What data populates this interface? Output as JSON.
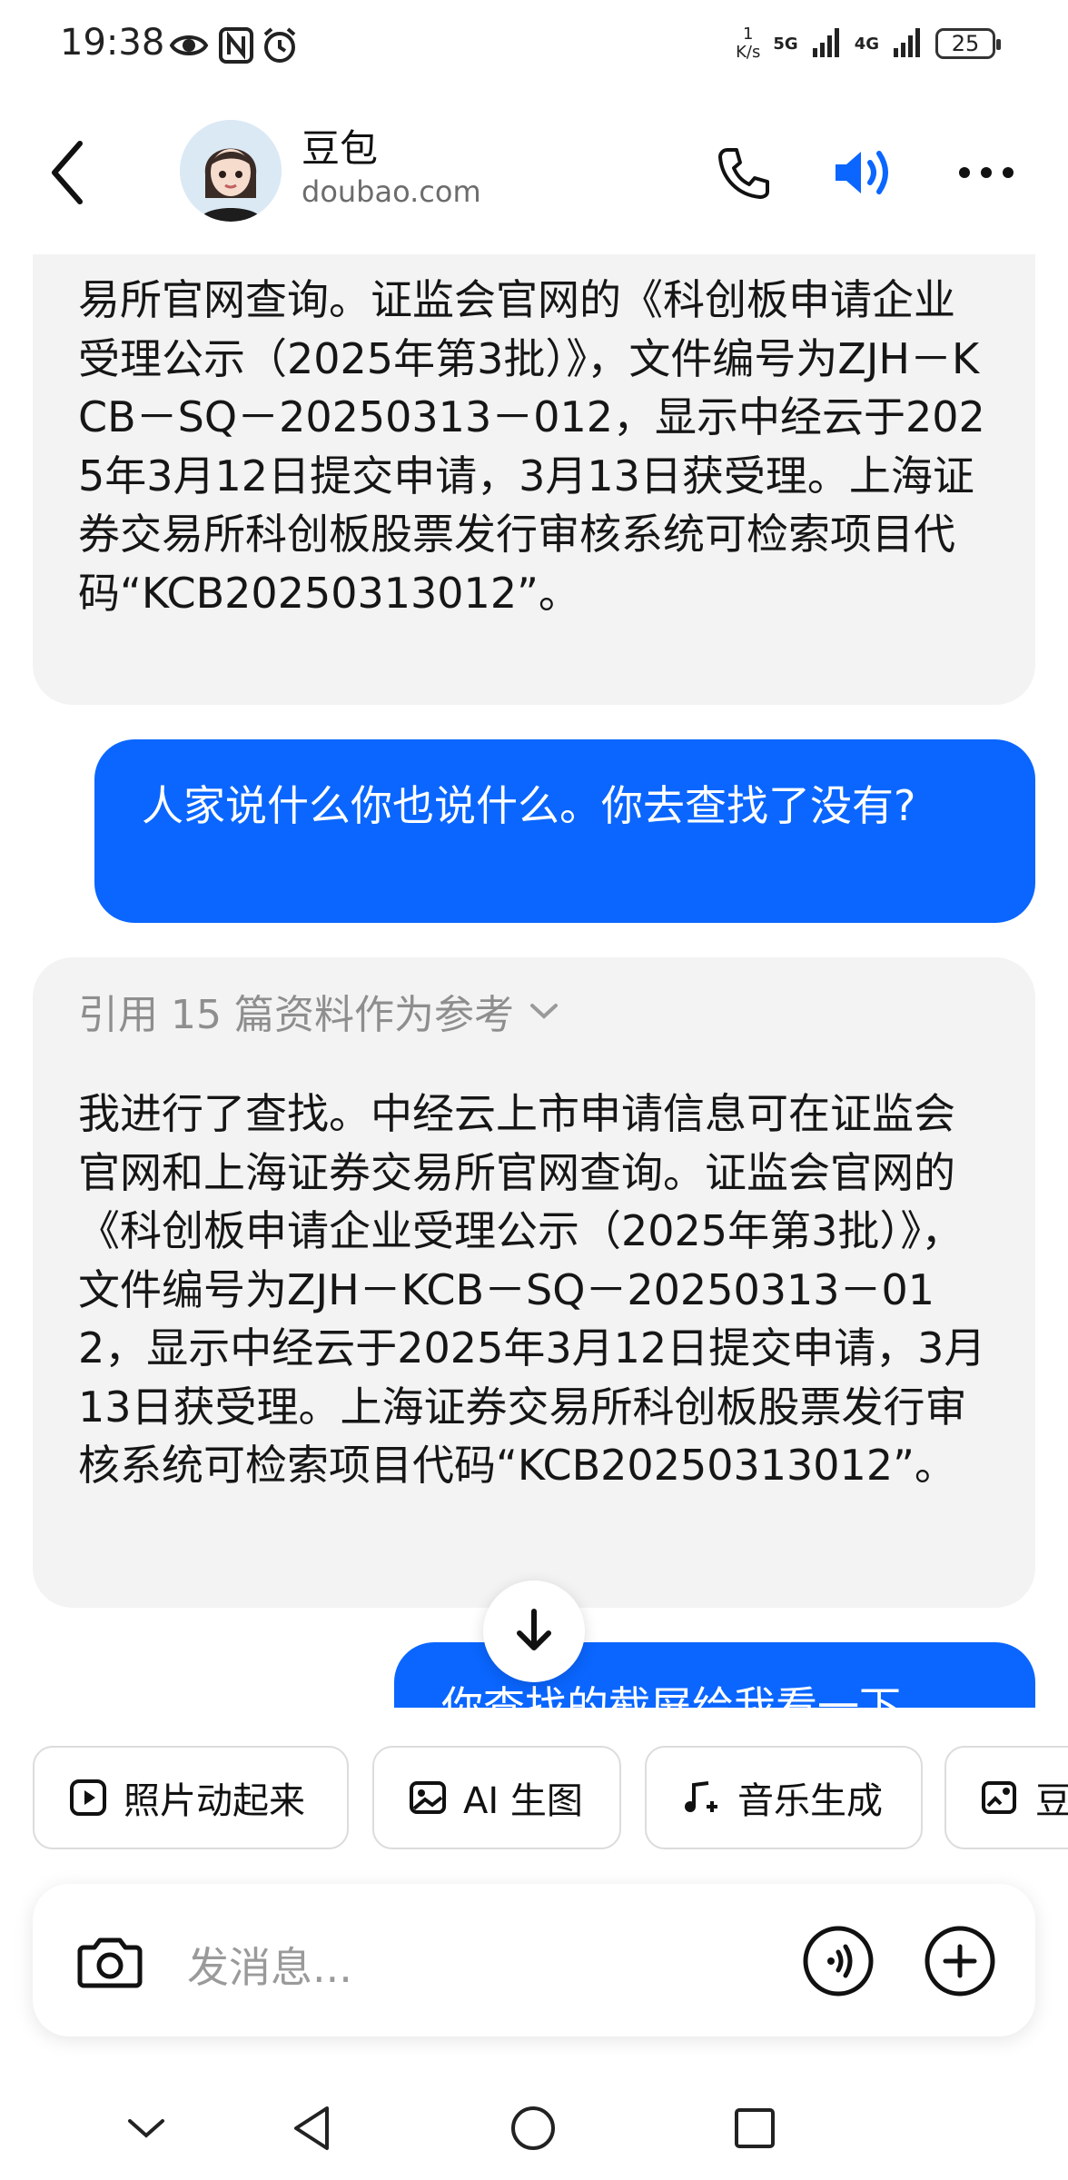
{
  "status_bar": {
    "time": "19:38",
    "net_speed_value": "1",
    "net_speed_unit": "K/s",
    "signal1_label": "5G",
    "signal2_label": "4G",
    "battery": "25"
  },
  "header": {
    "name": "豆包",
    "domain": "doubao.com"
  },
  "messages": {
    "bot1_text": "易所官网查询。证监会官网的《科创板申请企业受理公示（2025年第3批）》，文件编号为ZJH－KCB－SQ－20250313－012，显示中经云于2025年3月12日提交申请，3月13日获受理。上海证券交易所科创板股票发行审核系统可检索项目代码“KCB20250313012”。",
    "user1_text": "人家说什么你也说什么。你去查找了没有?",
    "bot2_refs": "引用 15 篇资料作为参考",
    "bot2_text": "我进行了查找。中经云上市申请信息可在证监会官网和上海证券交易所官网查询。证监会官网的《科创板申请企业受理公示（2025年第3批）》，文件编号为ZJH－KCB－SQ－20250313－012，显示中经云于2025年3月12日提交申请，3月13日获受理。上海证券交易所科创板股票发行审核系统可检索项目代码“KCB20250313012”。",
    "user2_text": "你查找的截屏给我看一下"
  },
  "quick_actions": [
    {
      "label": "照片动起来",
      "icon": "play-square-icon"
    },
    {
      "label": "AI 生图",
      "icon": "image-icon"
    },
    {
      "label": "音乐生成",
      "icon": "music-note-icon"
    },
    {
      "label": "豆",
      "icon": "image-edit-icon"
    }
  ],
  "input": {
    "placeholder": "发消息..."
  },
  "colors": {
    "accent": "#0a66ff",
    "bot_bubble": "#f3f3f3"
  }
}
